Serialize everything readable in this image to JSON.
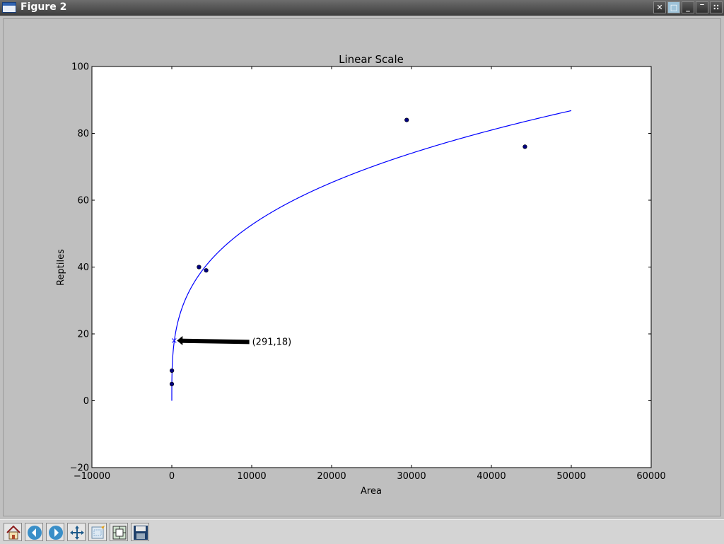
{
  "window": {
    "title": "Figure 2",
    "controls": [
      "close-icon",
      "maximize-icon",
      "minimize-icon",
      "shade-icon",
      "menu-icon"
    ]
  },
  "toolbar": {
    "buttons": [
      "home-icon",
      "back-icon",
      "forward-icon",
      "pan-icon",
      "zoom-icon",
      "subplots-icon",
      "save-icon"
    ]
  },
  "chart_data": {
    "type": "scatter",
    "title": "Linear Scale",
    "xlabel": "Area",
    "ylabel": "Reptiles",
    "xlim": [
      -10000,
      60000
    ],
    "ylim": [
      -20,
      100
    ],
    "xticks": [
      -10000,
      0,
      10000,
      20000,
      30000,
      40000,
      50000,
      60000
    ],
    "yticks": [
      -20,
      0,
      20,
      40,
      60,
      80,
      100
    ],
    "grid": false,
    "points": [
      {
        "x": 0,
        "y": 5
      },
      {
        "x": 10,
        "y": 9
      },
      {
        "x": 3400,
        "y": 40
      },
      {
        "x": 4300,
        "y": 39
      },
      {
        "x": 29400,
        "y": 84
      },
      {
        "x": 44200,
        "y": 76
      }
    ],
    "fit_curve": {
      "type": "power",
      "a": 3.0,
      "b": 0.311,
      "x_range": [
        0,
        50000
      ]
    },
    "highlight": {
      "x": 291,
      "y": 18,
      "marker": "x"
    },
    "annotation": {
      "text": "(291,18)",
      "x": 291,
      "y": 18
    },
    "colors": {
      "points": "#00007f",
      "curve": "#0000ff",
      "annotation_arrow": "#000000"
    }
  }
}
